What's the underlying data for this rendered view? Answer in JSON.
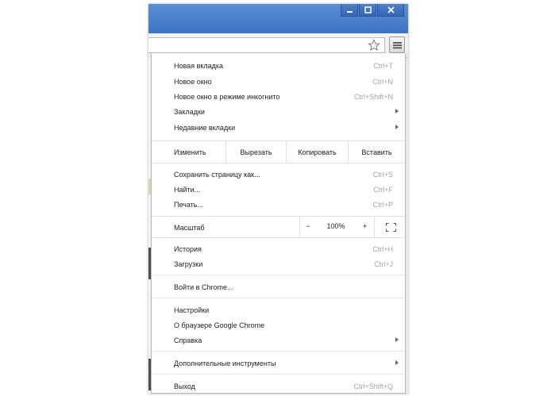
{
  "window": {
    "controls": {
      "minimize_icon": "minimize-icon",
      "maximize_icon": "maximize-icon",
      "close_icon": "close-icon"
    },
    "titlebar_color": "#4a80cf"
  },
  "toolbar": {
    "bookmark_icon": "star-icon",
    "menu_icon": "hamburger-menu-icon"
  },
  "menu": {
    "new_tab": {
      "label": "Новая вкладка",
      "shortcut": "Ctrl+T"
    },
    "new_window": {
      "label": "Новое окно",
      "shortcut": "Ctrl+N"
    },
    "incognito": {
      "label": "Новое окно в режиме инкогнито",
      "shortcut": "Ctrl+Shift+N"
    },
    "bookmarks": {
      "label": "Закладки"
    },
    "recent_tabs": {
      "label": "Недавние вкладки"
    },
    "edit": {
      "label": "Изменить",
      "cut": "Вырезать",
      "copy": "Копировать",
      "paste": "Вставить"
    },
    "save_page": {
      "label": "Сохранить страницу как...",
      "shortcut": "Ctrl+S"
    },
    "find": {
      "label": "Найти...",
      "shortcut": "Ctrl+F"
    },
    "print": {
      "label": "Печать...",
      "shortcut": "Ctrl+P"
    },
    "zoom": {
      "label": "Масштаб",
      "minus": "−",
      "value": "100%",
      "plus": "+",
      "fullscreen_icon": "fullscreen-icon"
    },
    "history": {
      "label": "История",
      "shortcut": "Ctrl+H"
    },
    "downloads": {
      "label": "Загрузки",
      "shortcut": "Ctrl+J"
    },
    "sign_in": {
      "label": "Войти в Chrome..."
    },
    "settings": {
      "label": "Настройки"
    },
    "about": {
      "label": "О браузере Google Chrome"
    },
    "help": {
      "label": "Справка"
    },
    "more_tools": {
      "label": "Дополнительные инструменты"
    },
    "exit": {
      "label": "Выход",
      "shortcut": "Ctrl+Shift+Q"
    }
  }
}
